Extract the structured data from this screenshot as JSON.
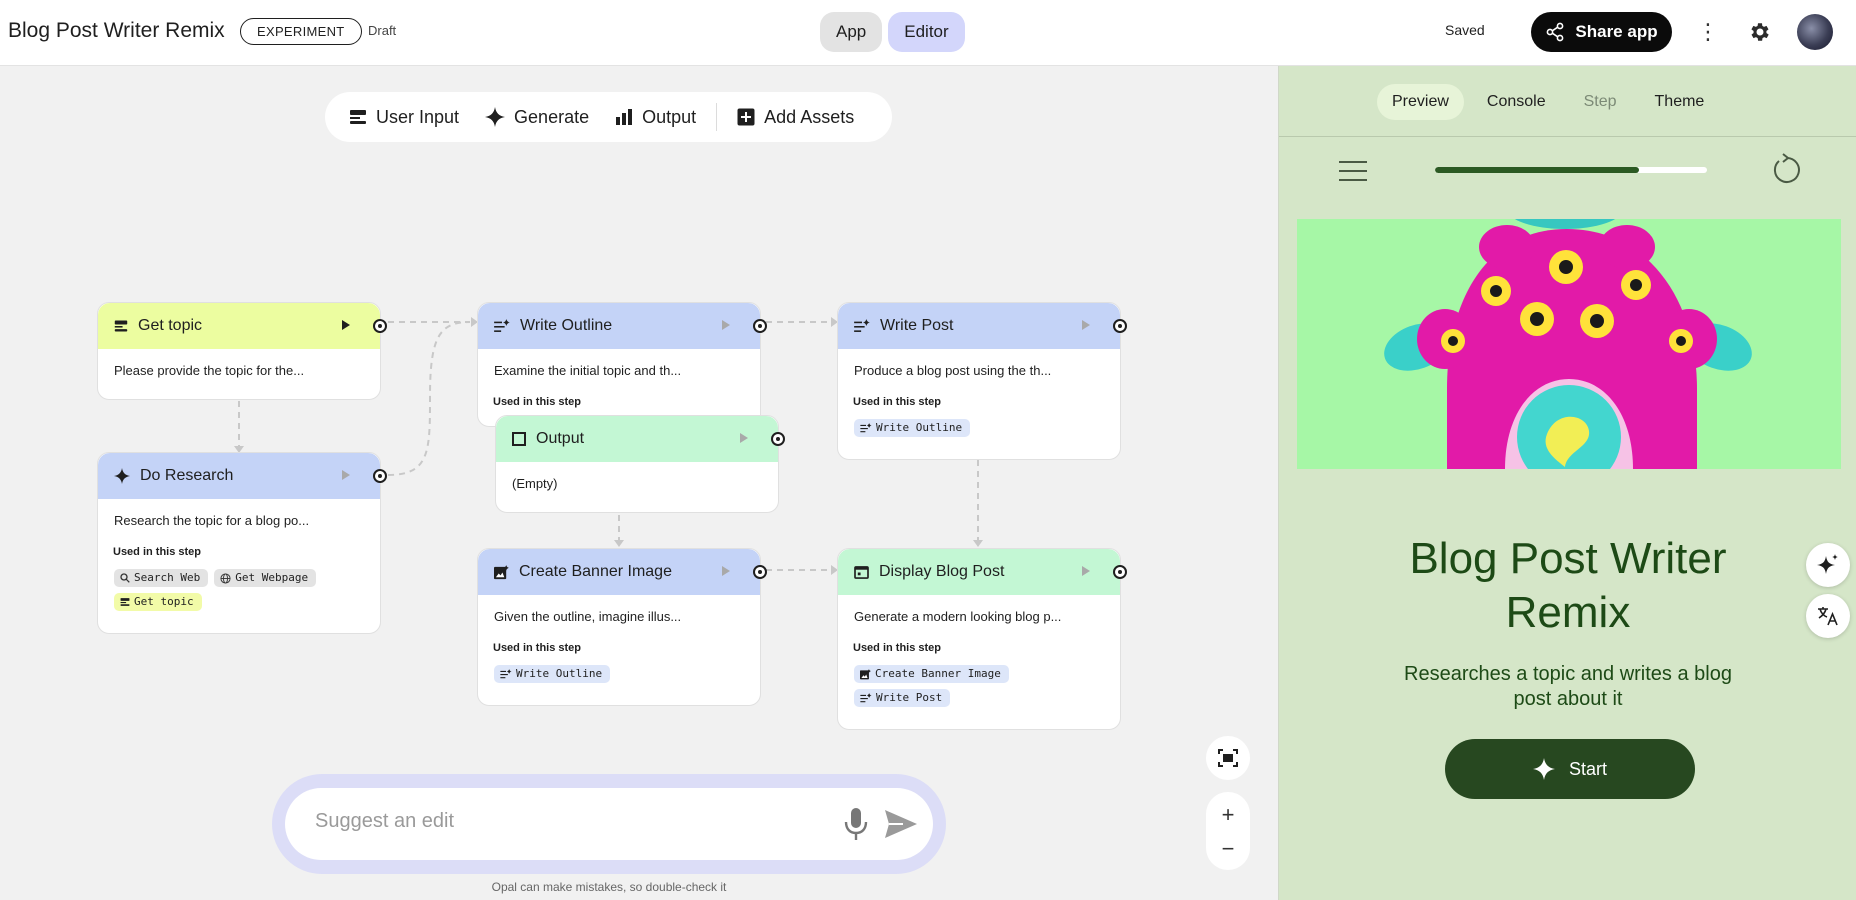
{
  "header": {
    "title": "Blog Post Writer Remix",
    "badge": "EXPERIMENT",
    "status": "Draft",
    "modes": [
      "App",
      "Editor"
    ],
    "active_mode": "Editor",
    "saved": "Saved",
    "share_label": "Share app"
  },
  "toolbar": {
    "user_input": "User Input",
    "generate": "Generate",
    "output": "Output",
    "add_assets": "Add Assets"
  },
  "nodes": {
    "get_topic": {
      "title": "Get topic",
      "desc": "Please provide the topic for the..."
    },
    "do_research": {
      "title": "Do Research",
      "desc": "Research the topic for a blog po...",
      "used": "Used in this step",
      "chips": [
        "Search Web",
        "Get Webpage",
        "Get topic"
      ]
    },
    "write_outline": {
      "title": "Write Outline",
      "desc": "Examine the initial topic and th...",
      "used": "Used in this step"
    },
    "output": {
      "title": "Output",
      "desc": "(Empty)"
    },
    "write_post": {
      "title": "Write Post",
      "desc": "Produce a blog post using the th...",
      "used": "Used in this step",
      "chips": [
        "Write Outline"
      ]
    },
    "create_banner": {
      "title": "Create Banner Image",
      "desc": "Given the outline, imagine illus...",
      "used": "Used in this step",
      "chips": [
        "Write Outline"
      ]
    },
    "display_post": {
      "title": "Display Blog Post",
      "desc": "Generate a modern looking blog p...",
      "used": "Used in this step",
      "chips": [
        "Create Banner Image",
        "Write Post"
      ]
    }
  },
  "suggest": {
    "placeholder": "Suggest an edit",
    "disclaimer": "Opal can make mistakes, so double-check it"
  },
  "zoom": {
    "plus": "+",
    "minus": "−"
  },
  "panel": {
    "tabs": [
      "Preview",
      "Console",
      "Step",
      "Theme"
    ],
    "active_tab": "Preview",
    "disabled_tab": "Step",
    "progress": 0.75,
    "app_title": "Blog Post Writer Remix",
    "app_subtitle": "Researches a topic and writes a blog post about it",
    "start_label": "Start"
  },
  "icons": {
    "user_input": "user-input-icon",
    "generate": "sparkle-icon",
    "output": "output-chart-icon",
    "add_assets": "plus-square-icon",
    "share": "share-icon",
    "settings": "gear-icon",
    "menu": "hamburger-icon",
    "refresh": "refresh-icon"
  },
  "colors": {
    "accent_dark": "#274820",
    "panel_bg": "#d5e6c8",
    "node_input": "#ecfda0",
    "node_generate": "#c4d3f7",
    "node_output": "#c3f7d4",
    "editor_active": "#d3d6fb"
  }
}
